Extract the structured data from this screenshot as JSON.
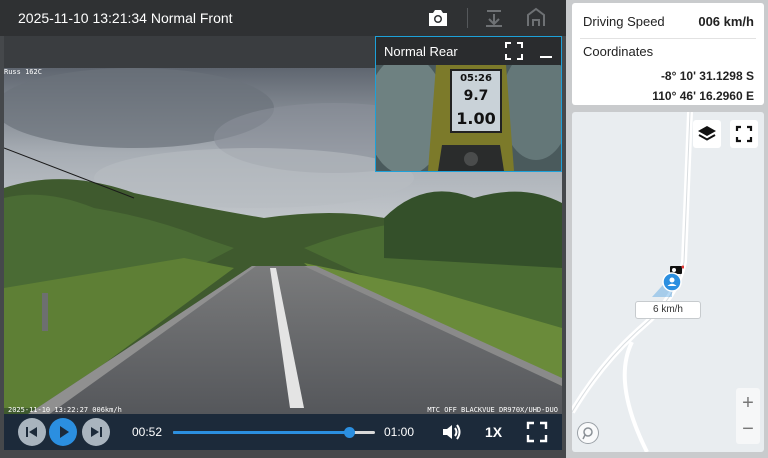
{
  "player": {
    "front_title": "2025-11-10 13:21:34 Normal Front",
    "toolbar": {
      "snapshot_icon": "camera-icon",
      "download_icon": "download-icon",
      "share_icon": "share-icon"
    },
    "rear_pip": {
      "title": "Normal Rear",
      "fullscreen_icon": "fullscreen-icon",
      "minimize_icon": "minimize-icon",
      "gps_display": [
        "05:26",
        "9.7",
        "1.00"
      ]
    },
    "osd": {
      "date": "2025-11-10 13:22:27 006km/h",
      "model": "MTC OFF BLACKVUE DR970X/UHD-DUO",
      "top_left": "Russ 162C"
    },
    "controls": {
      "prev_icon": "skip-back-icon",
      "play_icon": "play-icon",
      "next_icon": "skip-forward-icon",
      "current_time": "00:52",
      "total_time": "01:00",
      "progress": 0.87,
      "volume_icon": "volume-icon",
      "playback_rate": "1X",
      "fullscreen_icon": "fullscreen-icon"
    }
  },
  "info": {
    "speed_label": "Driving Speed",
    "speed_value": "006 km/h",
    "coordinates_label": "Coordinates",
    "latitude": "-8° 10' 31.1298 S",
    "longitude": "110° 46' 16.2960 E"
  },
  "map": {
    "layers_icon": "layers-icon",
    "fullscreen_icon": "fullscreen-icon",
    "speed_tag": "6 km/h",
    "zoom_in": "+",
    "zoom_out": "−",
    "road_color": "#ffffff",
    "accent": "#2b8fe0"
  },
  "colors": {
    "player_bg": "#45484b",
    "controls_bg": "#1c2a3a",
    "accent": "#2b8fe0",
    "pip_border": "#1da1d9"
  }
}
